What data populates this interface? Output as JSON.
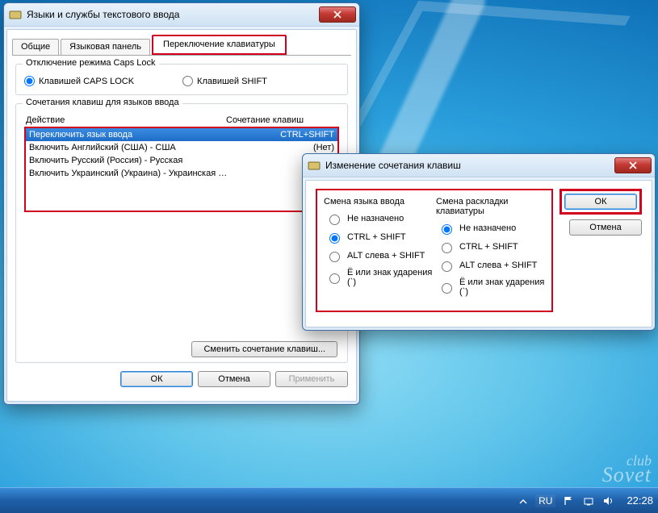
{
  "taskbar": {
    "lang": "RU",
    "time": "22:28"
  },
  "watermark": {
    "l1": "club",
    "l2": "Sovet"
  },
  "mainDialog": {
    "title": "Языки и службы текстового ввода",
    "tabs": [
      "Общие",
      "Языковая панель",
      "Переключение клавиатуры"
    ],
    "capsGroup": {
      "legend": "Отключение режима Caps Lock",
      "opt1": "Клавишей CAPS LOCK",
      "opt2": "Клавишей SHIFT"
    },
    "hotkeyGroup": {
      "legend": "Сочетания клавиш для языков ввода",
      "col1": "Действие",
      "col2": "Сочетание клавиш",
      "rows": [
        {
          "action": "Переключить язык ввода",
          "combo": "CTRL+SHIFT",
          "selected": true
        },
        {
          "action": "Включить Английский (США) - США",
          "combo": "(Нет)"
        },
        {
          "action": "Включить Русский (Россия) - Русская",
          "combo": "(Нет)"
        },
        {
          "action": "Включить Украинский (Украина) - Украинская (расшир...",
          "combo": ""
        }
      ],
      "changeBtn": "Сменить сочетание клавиш..."
    },
    "buttons": {
      "ok": "ОК",
      "cancel": "Отмена",
      "apply": "Применить"
    }
  },
  "subDialog": {
    "title": "Изменение сочетания клавиш",
    "leftPane": {
      "title": "Смена языка ввода",
      "options": [
        "Не назначено",
        "CTRL + SHIFT",
        "ALT слева + SHIFT",
        "Ё или знак ударения (`)"
      ],
      "selected": 1
    },
    "rightPane": {
      "title": "Смена раскладки клавиатуры",
      "options": [
        "Не назначено",
        "CTRL + SHIFT",
        "ALT слева + SHIFT",
        "Ё или знак ударения (`)"
      ],
      "selected": 0
    },
    "buttons": {
      "ok": "ОК",
      "cancel": "Отмена"
    }
  }
}
